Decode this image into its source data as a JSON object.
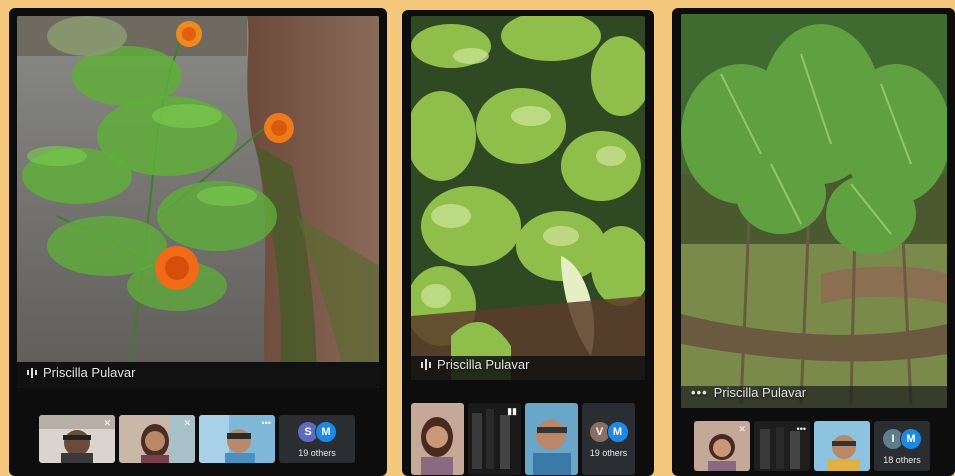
{
  "panels": [
    {
      "participant_name": "Priscilla Pulavar",
      "others_label": "19 others",
      "avatars": [
        {
          "letter": "S",
          "color": "#5c6bc0"
        },
        {
          "letter": "M",
          "color": "#1e88e5"
        }
      ]
    },
    {
      "participant_name": "Priscilla Pulavar",
      "others_label": "19 others",
      "avatars": [
        {
          "letter": "V",
          "color": "#8d6e63"
        },
        {
          "letter": "M",
          "color": "#1e88e5"
        }
      ]
    },
    {
      "participant_name": "Priscilla Pulavar",
      "others_label": "18 others",
      "avatars": [
        {
          "letter": "I",
          "color": "#607d8b"
        },
        {
          "letter": "M",
          "color": "#1e88e5"
        }
      ]
    }
  ],
  "colors": {
    "background": "#f4c97e",
    "phone_frame": "#0d0d0d",
    "others_tile": "#2a2d31"
  }
}
